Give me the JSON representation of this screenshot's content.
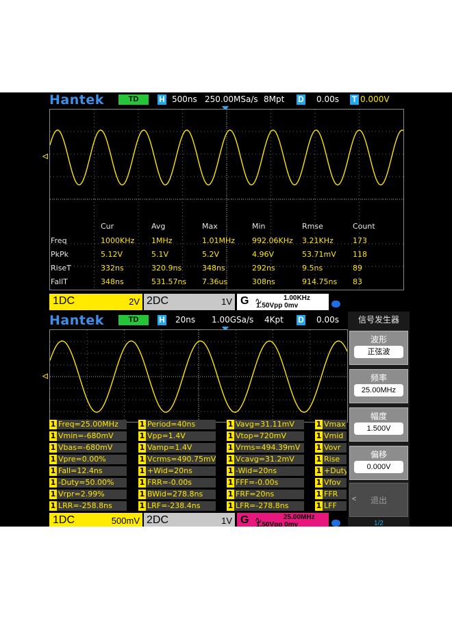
{
  "top": {
    "logo": "Hantek",
    "mode": "TD",
    "h_label": "H",
    "timebase": "500ns",
    "sample_rate": "250.00MSa/s",
    "memory": "8Mpt",
    "d_label": "D",
    "delay": "0.00s",
    "t_label": "T",
    "trigger_level": "0.000V",
    "measurements": {
      "headers": [
        "Cur",
        "Avg",
        "Max",
        "Min",
        "Rmse",
        "Count"
      ],
      "rows": [
        {
          "name": "Freq",
          "values": [
            "1000KHz",
            "1MHz",
            "1.01MHz",
            "992.06KHz",
            "3.21KHz",
            "173"
          ]
        },
        {
          "name": "PkPk",
          "values": [
            "5.12V",
            "5.1V",
            "5.2V",
            "4.96V",
            "53.71mV",
            "118"
          ]
        },
        {
          "name": "RiseT",
          "values": [
            "332ns",
            "320.9ns",
            "348ns",
            "292ns",
            "9.5ns",
            "89"
          ]
        },
        {
          "name": "FallT",
          "values": [
            "348ns",
            "531.57ns",
            "7.36us",
            "308ns",
            "914.75ns",
            "83"
          ]
        }
      ]
    },
    "ch1": {
      "label": "1DC",
      "scale": "2V"
    },
    "ch2": {
      "label": "2DC",
      "scale": "1V"
    },
    "gen": {
      "label": "G",
      "wave": "∿",
      "freq": "1.00KHz",
      "amp": "1.50Vpp  0mv"
    },
    "gen_color": "#ffffff"
  },
  "bottom": {
    "logo": "Hantek",
    "mode": "TD",
    "h_label": "H",
    "timebase": "20ns",
    "sample_rate": "1.00GSa/s",
    "memory": "4Kpt",
    "delay": "0.00s",
    "ch1": {
      "label": "1DC",
      "scale": "500mV"
    },
    "ch2": {
      "label": "2DC",
      "scale": "1V"
    },
    "gen": {
      "label": "G",
      "wave": "∿",
      "freq": "25.00MHz",
      "amp": "1.50Vpp  0mv"
    },
    "gen_color": "#e8177d",
    "meas_cols": [
      [
        "Freq=25.00MHz",
        "Vmin=-680mV",
        "Vbas=-680mV",
        "Vpre=0.00%",
        "Fall=12.4ns",
        "-Duty=50.00%",
        "Vrpr=2.99%",
        "LRR=-258.8ns"
      ],
      [
        "Period=40ns",
        "Vpp=1.4V",
        "Vamp=1.4V",
        "Vcrms=490.75mV",
        "+Wid=20ns",
        "FRR=-0.00s",
        "BWid=278.8ns",
        "LRF=-238.4ns"
      ],
      [
        "Vavg=31.11mV",
        "Vtop=720mV",
        "Vrms=494.39mV",
        "Vcavg=31.2mV",
        "-Wid=20ns",
        "FFF=-0.00s",
        "FRF=20ns",
        "LFR=-278.8ns"
      ],
      [
        "Vmax",
        "Vmid",
        "Vovr",
        "Rise",
        "+Duty",
        "Vfov",
        "FFR",
        "LFF"
      ]
    ],
    "ch_num": "1"
  },
  "panel": {
    "title": "信号发生器",
    "items": [
      {
        "label": "波形",
        "value": "正弦波"
      },
      {
        "label": "频率",
        "value": "25.00MHz"
      },
      {
        "label": "幅度",
        "value": "1.500V"
      },
      {
        "label": "偏移",
        "value": "0.000V"
      }
    ],
    "exit_label": "退出",
    "back_glyph": "<",
    "page": "1/2"
  },
  "colors": {
    "trace": "#ffe600",
    "accent": "#23a8ee",
    "logo": "#3f8fe8"
  }
}
